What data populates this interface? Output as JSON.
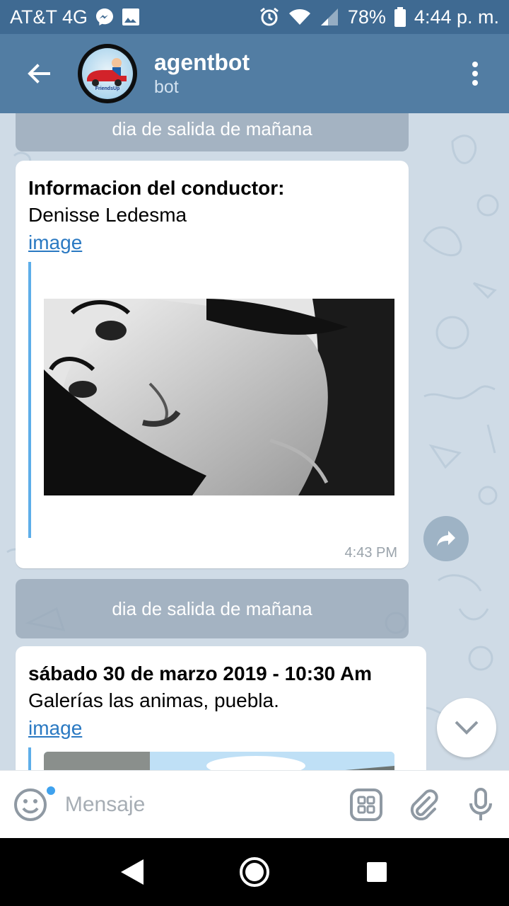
{
  "status_bar": {
    "carrier": "AT&T 4G",
    "battery": "78%",
    "time": "4:44 p. m."
  },
  "header": {
    "title": "agentbot",
    "subtitle": "bot",
    "avatar_text": "FriendsUp"
  },
  "messages": [
    {
      "type": "service_button",
      "label": "dia de salida de mañana"
    },
    {
      "type": "bubble",
      "title": "Informacion del conductor:",
      "body": "Denisse Ledesma",
      "link": "image",
      "time": "4:43 PM"
    },
    {
      "type": "service_button",
      "label": "dia de salida de mañana"
    },
    {
      "type": "bubble",
      "title": "sábado 30 de marzo 2019 - 10:30 Am",
      "body": "Galerías las animas, puebla.",
      "link": "image"
    }
  ],
  "input": {
    "placeholder": "Mensaje",
    "value": ""
  },
  "icons": {
    "back": "arrow-left-icon",
    "menu": "more-vert-icon",
    "emoji": "smile-icon",
    "keyboard": "bot-keyboard-icon",
    "attach": "paperclip-icon",
    "mic": "microphone-icon"
  },
  "colors": {
    "header": "#527da3",
    "status_bar": "#3f6a92",
    "link": "#2a79c2",
    "quote_bar": "#5eaee9",
    "chat_bg": "#cfdbe6"
  }
}
